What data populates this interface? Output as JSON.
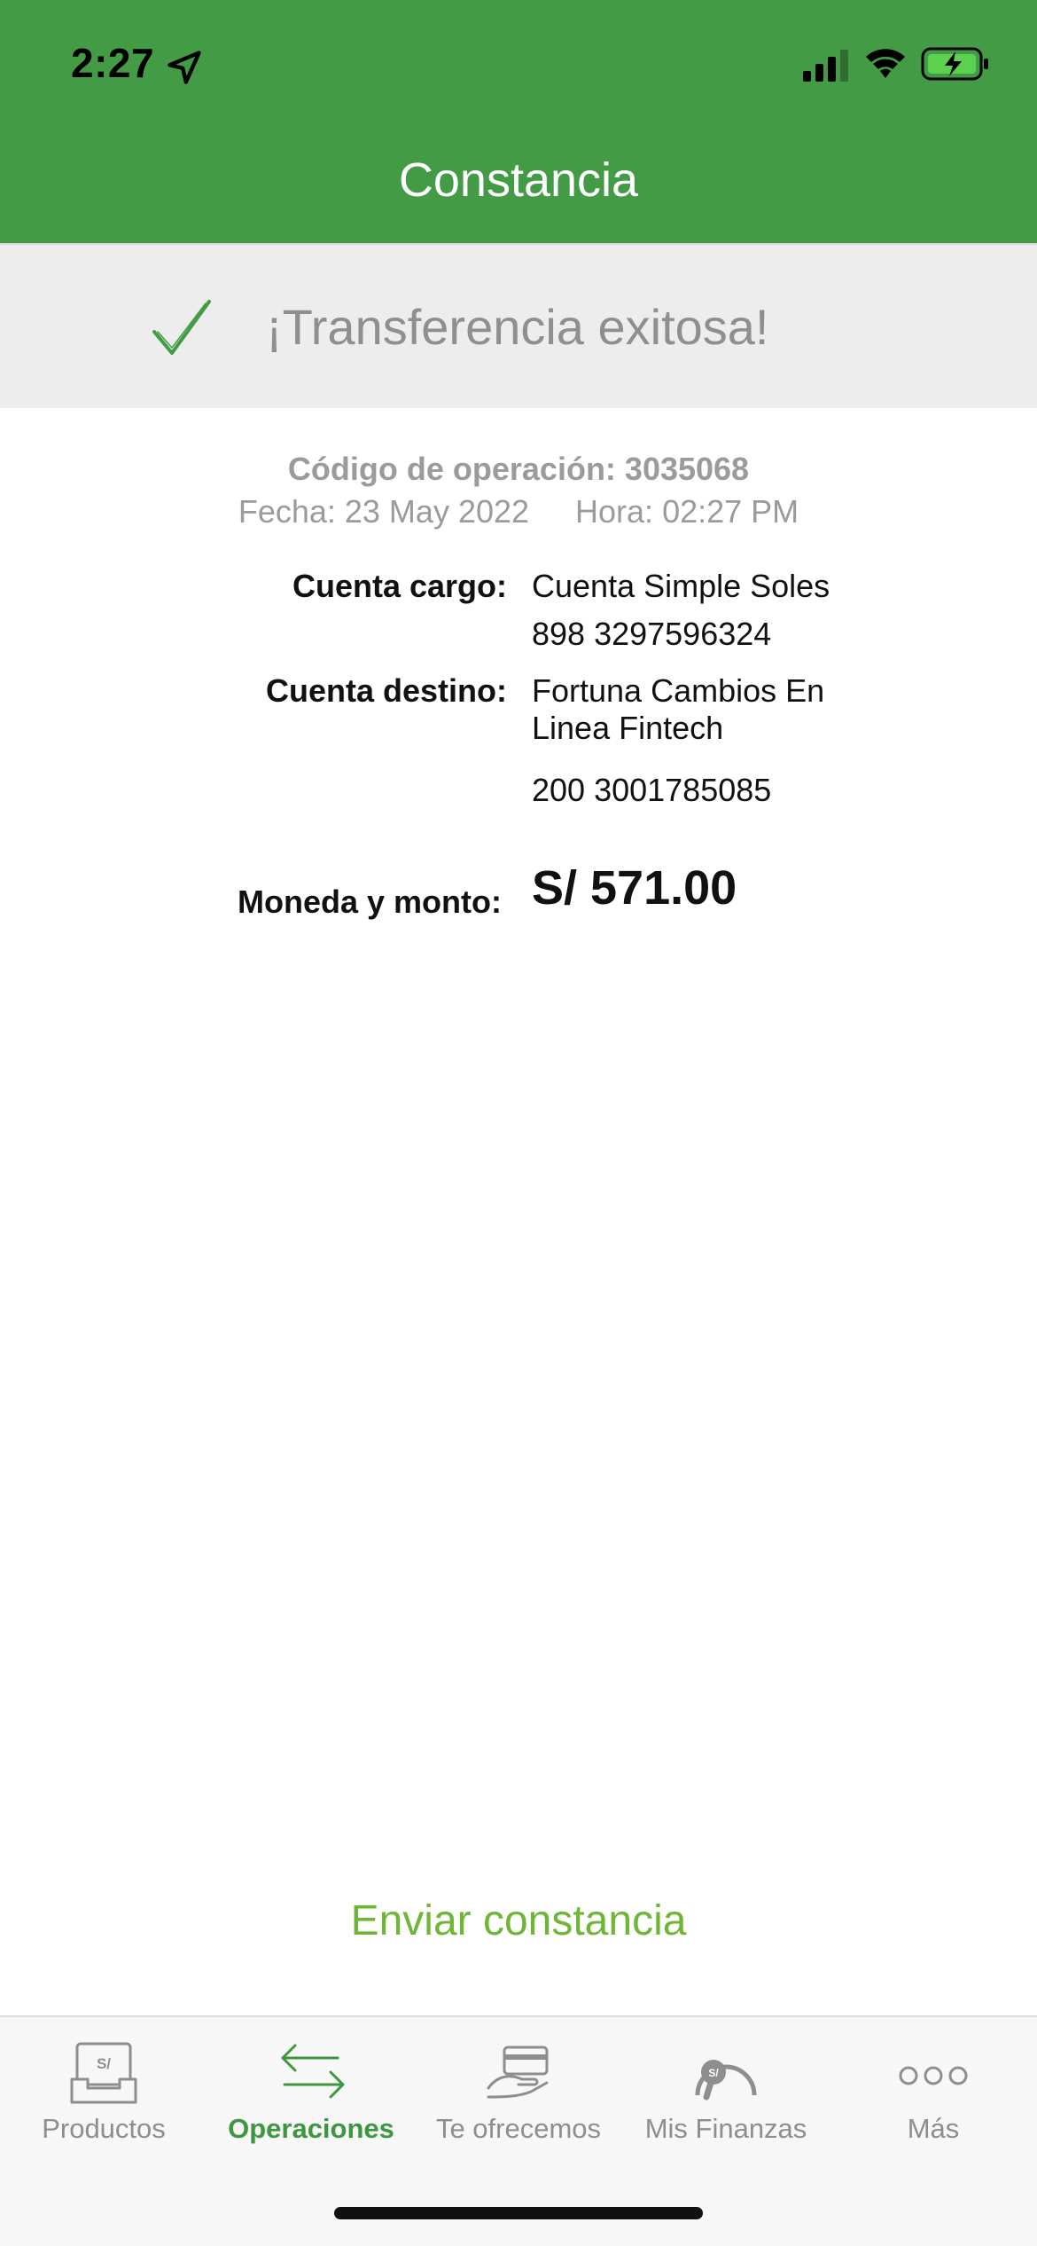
{
  "status_bar": {
    "time": "2:27"
  },
  "header": {
    "title": "Constancia"
  },
  "banner": {
    "message": "¡Transferencia exitosa!"
  },
  "operation": {
    "code_label": "Código de operación: 3035068",
    "date": "Fecha: 23 May 2022",
    "time": "Hora: 02:27 PM"
  },
  "details": {
    "cargo_label": "Cuenta cargo:",
    "cargo_name": "Cuenta Simple Soles",
    "cargo_number": "898 3297596324",
    "destino_label": "Cuenta destino:",
    "destino_name_line1": "Fortuna Cambios En",
    "destino_name_line2": "Linea Fintech",
    "destino_number": "200 3001785085",
    "amount_label": "Moneda y monto:",
    "amount_value": "S/ 571.00"
  },
  "actions": {
    "send_receipt": "Enviar constancia"
  },
  "tabbar": {
    "items": [
      {
        "label": "Productos",
        "icon": "products-icon"
      },
      {
        "label": "Operaciones",
        "icon": "transfer-arrows-icon",
        "active": true
      },
      {
        "label": "Te ofrecemos",
        "icon": "card-hand-icon"
      },
      {
        "label": "Mis Finanzas",
        "icon": "gauge-icon"
      },
      {
        "label": "Más",
        "icon": "more-dots-icon"
      }
    ]
  },
  "colors": {
    "primary": "#449b46",
    "accent_text": "#6fb637",
    "band": "#ededed"
  }
}
